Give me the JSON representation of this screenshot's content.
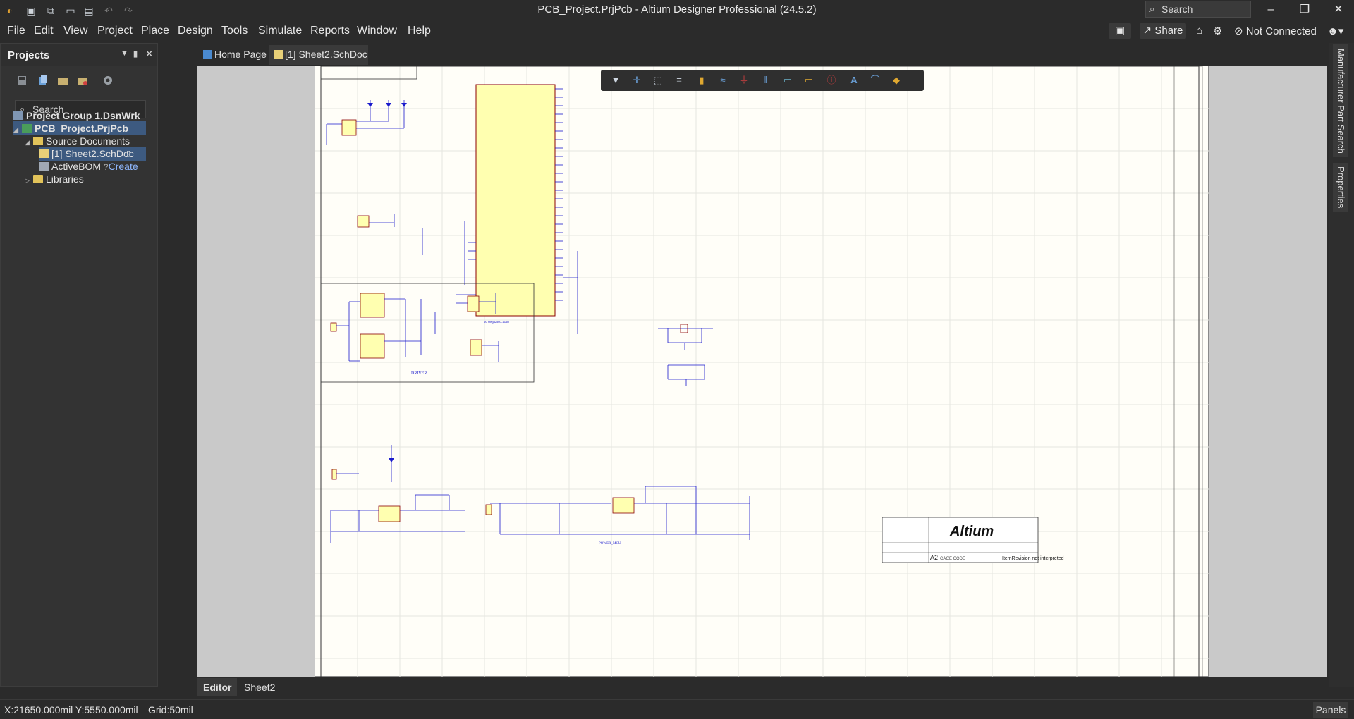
{
  "window": {
    "title": "PCB_Project.PrjPcb - Altium Designer Professional (24.5.2)",
    "search_placeholder": "Search",
    "minimize_icon": "minimize-icon",
    "maximize_icon": "restore-icon",
    "close_icon": "close-icon"
  },
  "menu": {
    "items": [
      "File",
      "Edit",
      "View",
      "Project",
      "Place",
      "Design",
      "Tools",
      "Simulate",
      "Reports",
      "Window",
      "Help"
    ]
  },
  "toolbar_right": {
    "share_label": "Share",
    "connection_status": "Not Connected"
  },
  "projects_panel": {
    "title": "Projects",
    "search_placeholder": "Search",
    "tree": [
      {
        "label": "Project Group 1.DsnWrk",
        "level": 0,
        "bold": true
      },
      {
        "label": "PCB_Project.PrjPcb",
        "level": 1,
        "bold": true,
        "selected": true
      },
      {
        "label": "Source Documents",
        "level": 2
      },
      {
        "label": "[1] Sheet2.SchDoc",
        "level": 3,
        "selected": true
      },
      {
        "label": "ActiveBOM",
        "level": 3,
        "action": "Create"
      },
      {
        "label": "Libraries",
        "level": 2
      }
    ]
  },
  "tabs": {
    "home_label": "Home Page",
    "doc_label": "[1] Sheet2.SchDoc"
  },
  "schematic": {
    "mcu_label": "ATmega2560-16AU",
    "driver_label": "DRIVER",
    "power_mcu_label": "POWER_MCU",
    "title_block_logo": "Altium",
    "title_block_size": "A2",
    "title_block_cage": "CAGE CODE",
    "title_block_note": "ItemRevision not interpreted"
  },
  "bottom_tabs": {
    "editor_label": "Editor",
    "sheet_label": "Sheet2"
  },
  "status": {
    "coords": "X:21650.000mil Y:5550.000mil",
    "grid": "Grid:50mil",
    "panels_label": "Panels"
  },
  "right_panels": {
    "items": [
      "Manufacturer Part Search",
      "Properties"
    ]
  },
  "colors": {
    "background": "#2b2b2b",
    "sheet": "#fffef8",
    "component_fill": "#ffffb0",
    "wire": "#1a1acc",
    "component_outline": "#8b0000"
  }
}
